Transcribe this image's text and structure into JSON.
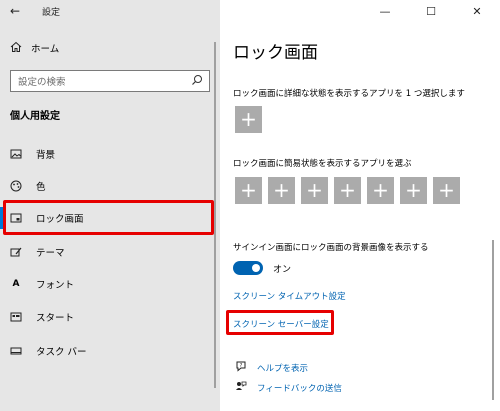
{
  "window": {
    "title": "設定",
    "back_icon": "back-arrow-icon",
    "controls": [
      "—",
      "☐",
      "✕"
    ]
  },
  "sidebar": {
    "home_label": "ホーム",
    "search_placeholder": "設定の検索",
    "section_title": "個人用設定",
    "items": [
      {
        "label": "背景",
        "icon": "image-icon"
      },
      {
        "label": "色",
        "icon": "palette-icon"
      },
      {
        "label": "ロック画面",
        "icon": "lock-screen-icon",
        "selected": true
      },
      {
        "label": "テーマ",
        "icon": "theme-icon"
      },
      {
        "label": "フォント",
        "icon": "font-icon"
      },
      {
        "label": "スタート",
        "icon": "start-icon"
      },
      {
        "label": "タスク バー",
        "icon": "taskbar-icon"
      }
    ]
  },
  "main": {
    "title": "ロック画面",
    "detail_label": "ロック画面に詳細な状態を表示するアプリを 1 つ選択します",
    "quick_label": "ロック画面に簡易状態を表示するアプリを選ぶ",
    "plus": "+",
    "signin_label": "サインイン画面にロック画面の背景画像を表示する",
    "toggle_state": "オン",
    "link_timeout": "スクリーン タイムアウト設定",
    "link_screensaver": "スクリーン セーバー設定",
    "help_label": "ヘルプを表示",
    "feedback_label": "フィードバックの送信"
  },
  "colors": {
    "accent": "#0078d7",
    "highlight": "#e60000",
    "link": "#0063b1"
  }
}
